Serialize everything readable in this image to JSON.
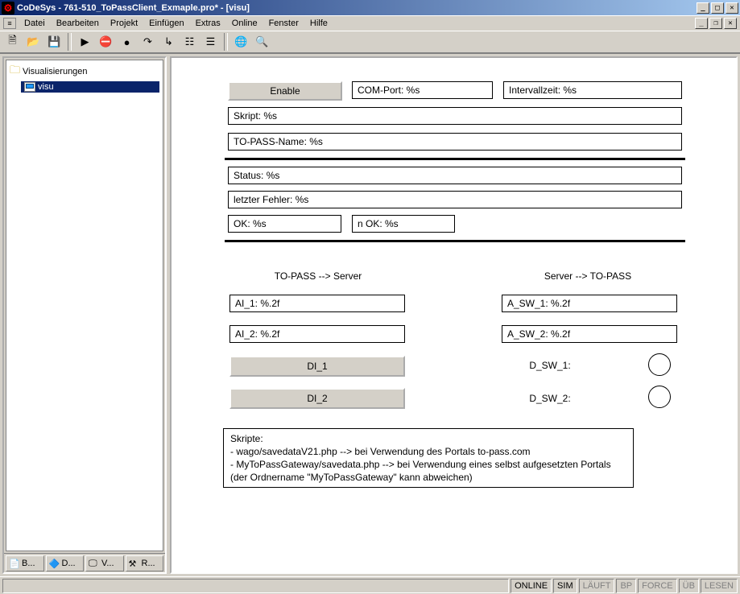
{
  "title": "CoDeSys - 761-510_ToPassClient_Exmaple.pro* - [visu]",
  "menu": {
    "datei": "Datei",
    "bearbeiten": "Bearbeiten",
    "projekt": "Projekt",
    "einfuegen": "Einfügen",
    "extras": "Extras",
    "online": "Online",
    "fenster": "Fenster",
    "hilfe": "Hilfe"
  },
  "tree": {
    "root": "Visualisierungen",
    "child": "visu"
  },
  "tabs": {
    "b": "B...",
    "d": "D...",
    "v": "V...",
    "r": "R..."
  },
  "visu": {
    "enable": "Enable",
    "comport": "COM-Port: %s",
    "intervall": "Intervallzeit: %s",
    "skript": "Skript: %s",
    "topassname": "TO-PASS-Name: %s",
    "status": "Status: %s",
    "letzterfehler": "letzter Fehler: %s",
    "ok": "OK: %s",
    "nok": "n OK: %s",
    "hdr_left": "TO-PASS --> Server",
    "hdr_right": "Server --> TO-PASS",
    "ai1": "AI_1: %.2f",
    "ai2": "AI_2: %.2f",
    "di1": "DI_1",
    "di2": "DI_2",
    "asw1": "A_SW_1: %.2f",
    "asw2": "A_SW_2: %.2f",
    "dsw1": "D_SW_1:",
    "dsw2": "D_SW_2:",
    "note_title": "Skripte:",
    "note_l1": " - wago/savedataV21.php --> bei Verwendung des Portals to-pass.com",
    "note_l2": " - MyToPassGateway/savedata.php --> bei Verwendung eines selbst aufgesetzten Portals",
    "note_l3": "   (der Ordnername \"MyToPassGateway\" kann abweichen)"
  },
  "status": {
    "online": "ONLINE",
    "sim": "SIM",
    "lauft": "LÄUFT",
    "bp": "BP",
    "force": "FORCE",
    "ub": "ÜB",
    "lesen": "LESEN"
  }
}
